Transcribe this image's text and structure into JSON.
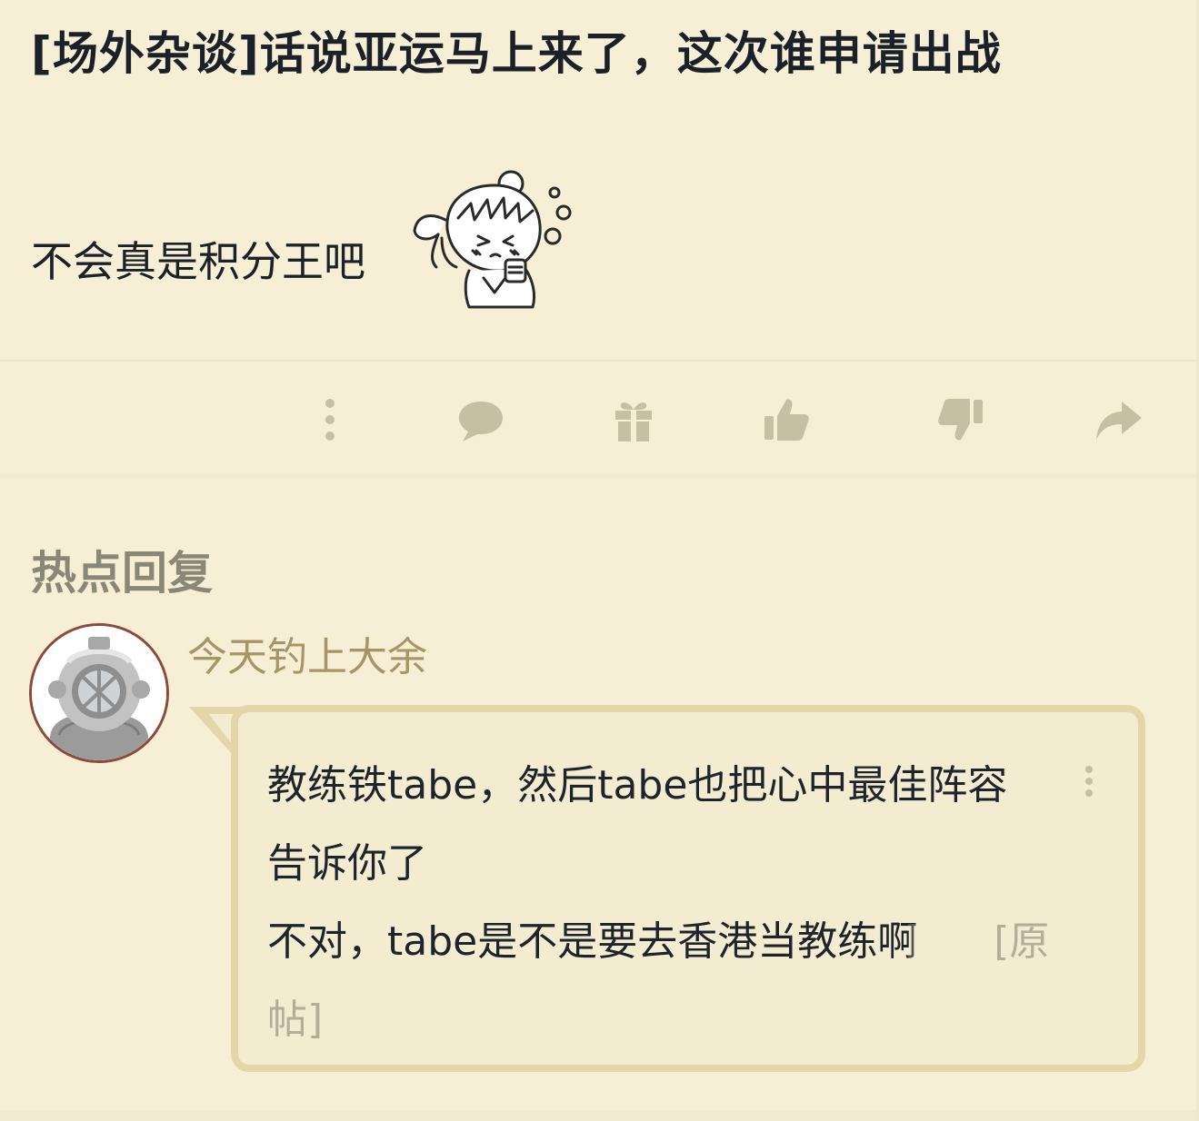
{
  "post": {
    "title": "[场外杂谈]话说亚运马上来了，这次谁申请出战",
    "body": "不会真是积分王吧"
  },
  "actions": [
    {
      "name": "more-actions",
      "icon": "vertical-dots-icon"
    },
    {
      "name": "reply",
      "icon": "speech-bubble-icon"
    },
    {
      "name": "gift",
      "icon": "gift-icon"
    },
    {
      "name": "like",
      "icon": "thumbs-up-icon"
    },
    {
      "name": "dislike",
      "icon": "thumbs-down-icon"
    },
    {
      "name": "share",
      "icon": "share-arrow-icon"
    }
  ],
  "hot_replies": {
    "heading": "热点回复",
    "items": [
      {
        "username": "今天钓上大余",
        "line1": "教练铁tabe，然后tabe也把心中最佳阵容",
        "line2": "告诉你了",
        "line3": "不对，tabe是不是要去香港当教练啊",
        "link_part1": "[原",
        "link_part2": "帖]"
      }
    ]
  },
  "colors": {
    "background": "#f6efd6",
    "icon": "#c6bfa4",
    "username": "#a59668",
    "bubble_border": "#e3d6a9",
    "heading": "#8b8776"
  }
}
